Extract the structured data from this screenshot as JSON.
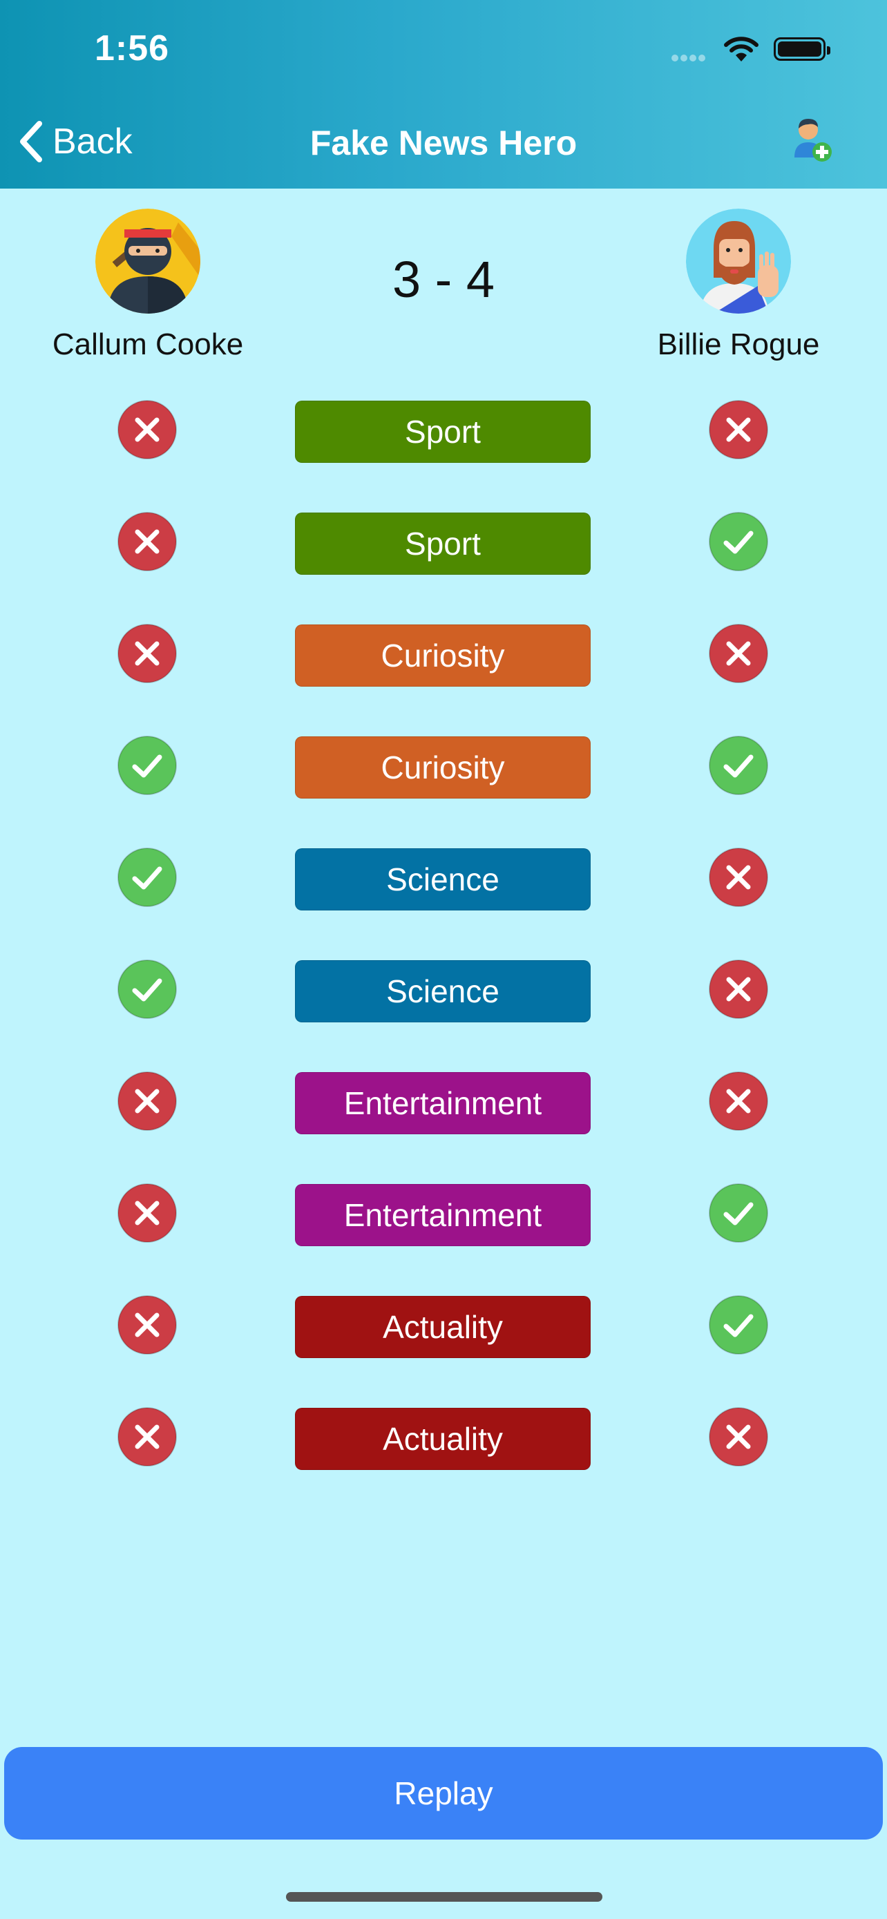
{
  "status_bar": {
    "time": "1:56"
  },
  "nav": {
    "back_label": "Back",
    "title": "Fake News Hero",
    "add_user_icon": "add-user-icon"
  },
  "match": {
    "player1": {
      "name": "Callum Cooke",
      "avatar": "ninja-avatar"
    },
    "player2": {
      "name": "Billie Rogue",
      "avatar": "bearded-man-avatar"
    },
    "score": "3 - 4"
  },
  "rounds": [
    {
      "category": "Sport",
      "color": "#4e8a00",
      "p1": "wrong",
      "p2": "wrong"
    },
    {
      "category": "Sport",
      "color": "#4e8a00",
      "p1": "wrong",
      "p2": "correct"
    },
    {
      "category": "Curiosity",
      "color": "#d06024",
      "p1": "wrong",
      "p2": "wrong"
    },
    {
      "category": "Curiosity",
      "color": "#d06024",
      "p1": "correct",
      "p2": "correct"
    },
    {
      "category": "Science",
      "color": "#0372a4",
      "p1": "correct",
      "p2": "wrong"
    },
    {
      "category": "Science",
      "color": "#0372a4",
      "p1": "correct",
      "p2": "wrong"
    },
    {
      "category": "Entertainment",
      "color": "#9c128a",
      "p1": "wrong",
      "p2": "wrong"
    },
    {
      "category": "Entertainment",
      "color": "#9c128a",
      "p1": "wrong",
      "p2": "correct"
    },
    {
      "category": "Actuality",
      "color": "#a01212",
      "p1": "wrong",
      "p2": "correct"
    },
    {
      "category": "Actuality",
      "color": "#a01212",
      "p1": "wrong",
      "p2": "wrong"
    }
  ],
  "result_colors": {
    "correct": "#5ac45a",
    "wrong": "#cc3d45"
  },
  "actions": {
    "replay_label": "Replay"
  }
}
